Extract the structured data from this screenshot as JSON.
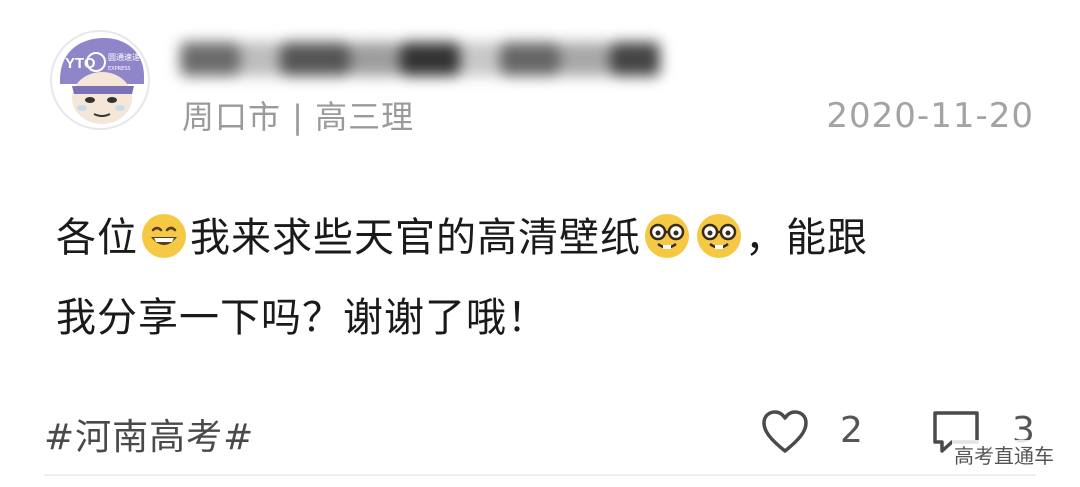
{
  "post": {
    "location_grade": "周口市 | 高三理",
    "date": "2020-11-20",
    "content": {
      "segment_1": "各位",
      "emoji_1": "grinning-face",
      "segment_2": "我来求些天官的高清壁纸",
      "emoji_2": "nerd-face",
      "emoji_3": "nerd-face",
      "segment_3": "，能跟",
      "line_2": "我分享一下吗？谢谢了哦！"
    },
    "tag": "#河南高考#",
    "likes": "2",
    "comments": "3"
  },
  "avatar": {
    "badge_text": "YTO",
    "cap_text": "圆通速递",
    "cap_subtext": "EXPRESS"
  },
  "watermark": "高考直通车",
  "colors": {
    "avatar_cap": "#8f86c9",
    "emoji_yellow": "#f6c945",
    "meta_gray": "#9a9a9a"
  }
}
